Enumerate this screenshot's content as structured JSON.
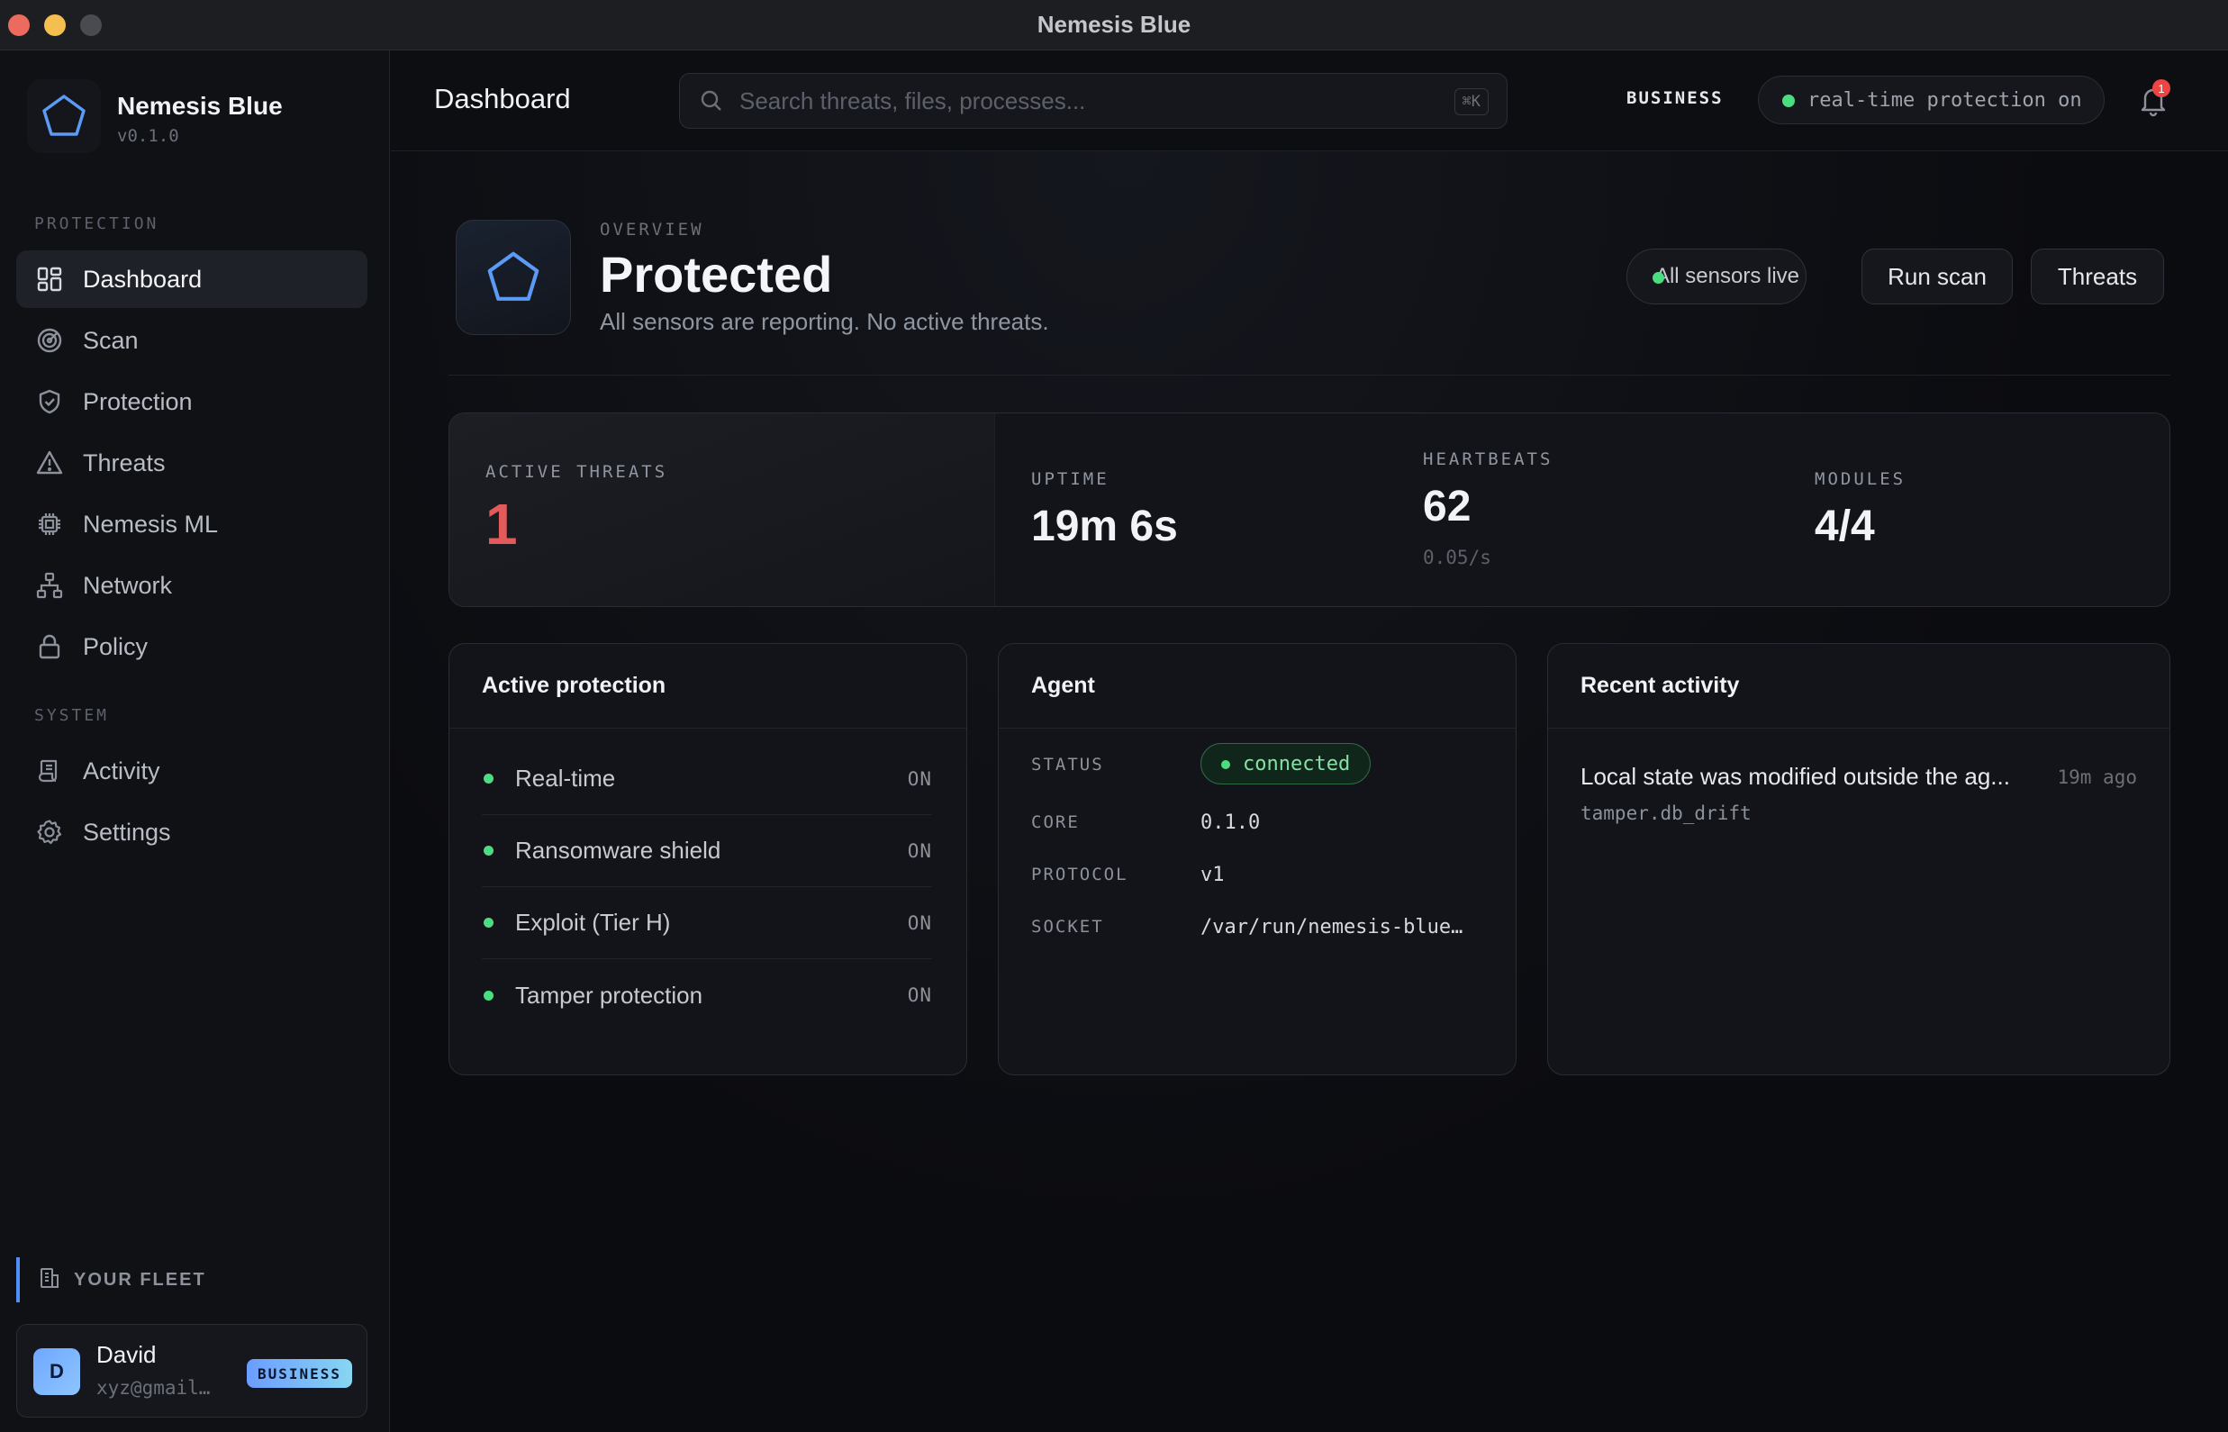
{
  "window": {
    "title": "Nemesis Blue"
  },
  "brand": {
    "name": "Nemesis Blue",
    "version": "v0.1.0"
  },
  "sidebar": {
    "sections": [
      {
        "label": "PROTECTION"
      },
      {
        "label": "SYSTEM"
      }
    ],
    "items": [
      {
        "label": "Dashboard",
        "icon": "grid-icon",
        "active": true
      },
      {
        "label": "Scan",
        "icon": "radar-icon"
      },
      {
        "label": "Protection",
        "icon": "shield-check-icon"
      },
      {
        "label": "Threats",
        "icon": "warning-triangle-icon"
      },
      {
        "label": "Nemesis ML",
        "icon": "chip-icon"
      },
      {
        "label": "Network",
        "icon": "network-icon"
      },
      {
        "label": "Policy",
        "icon": "lock-icon"
      },
      {
        "label": "Activity",
        "icon": "scroll-icon"
      },
      {
        "label": "Settings",
        "icon": "gear-icon"
      }
    ],
    "fleet_label": "YOUR FLEET",
    "user": {
      "initial": "D",
      "name": "David",
      "email": "xyz@gmail…",
      "badge": "BUSINESS"
    }
  },
  "topbar": {
    "title": "Dashboard",
    "search_placeholder": "Search threats, files, processes...",
    "search_shortcut": "⌘K",
    "plan": "BUSINESS",
    "protection_status": "real-time protection on",
    "notification_count": "1"
  },
  "overview": {
    "overline": "OVERVIEW",
    "title": "Protected",
    "subtitle": "All sensors are reporting. No active threats.",
    "sensors_label": "All sensors live",
    "run_scan_label": "Run scan",
    "threats_label": "Threats"
  },
  "stats": {
    "active_threats": {
      "label": "ACTIVE THREATS",
      "value": "1"
    },
    "uptime": {
      "label": "UPTIME",
      "value": "19m 6s"
    },
    "heartbeats": {
      "label": "HEARTBEATS",
      "value": "62",
      "sub": "0.05/s"
    },
    "modules": {
      "label": "MODULES",
      "value": "4/4"
    }
  },
  "active_protection": {
    "title": "Active protection",
    "rows": [
      {
        "label": "Real-time",
        "value": "ON"
      },
      {
        "label": "Ransomware shield",
        "value": "ON"
      },
      {
        "label": "Exploit (Tier H)",
        "value": "ON"
      },
      {
        "label": "Tamper protection",
        "value": "ON"
      }
    ]
  },
  "agent": {
    "title": "Agent",
    "status_key": "STATUS",
    "status_value": "connected",
    "core_key": "CORE",
    "core_value": "0.1.0",
    "protocol_key": "PROTOCOL",
    "protocol_value": "v1",
    "socket_key": "SOCKET",
    "socket_value": "/var/run/nemesis-blue…"
  },
  "recent_activity": {
    "title": "Recent activity",
    "items": [
      {
        "text": "Local state was modified outside the ag...",
        "time": "19m ago",
        "code": "tamper.db_drift"
      }
    ]
  },
  "colors": {
    "accent": "#5b9bf5",
    "ok": "#4ade80",
    "danger": "#e25a5a",
    "background": "#0b0c10"
  }
}
